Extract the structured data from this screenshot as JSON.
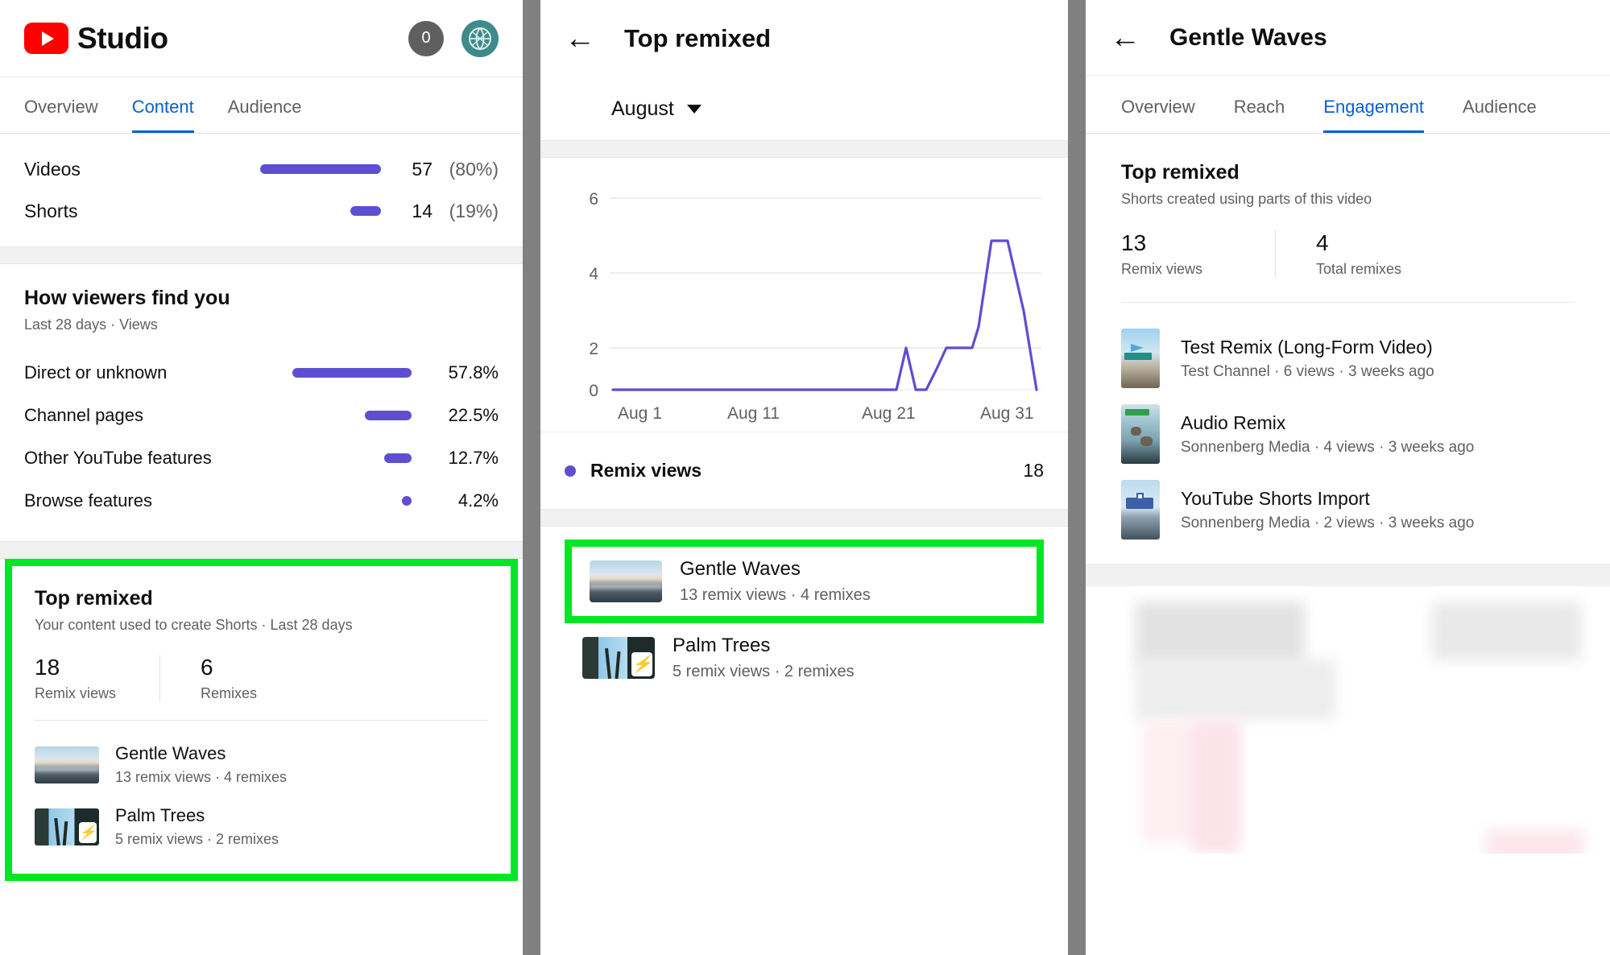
{
  "left": {
    "brand": {
      "name": "Studio",
      "logo_icon": "youtube-logo-icon",
      "badge_count": "0",
      "avatar_icon": "channel-avatar-icon"
    },
    "tabs": [
      {
        "label": "Overview",
        "active": false
      },
      {
        "label": "Content",
        "active": true
      },
      {
        "label": "Audience",
        "active": false
      }
    ],
    "content_breakdown": [
      {
        "label": "Videos",
        "count": "57",
        "pct": "(80%)",
        "bar_pct": 80
      },
      {
        "label": "Shorts",
        "count": "14",
        "pct": "(19%)",
        "bar_pct": 19
      }
    ],
    "traffic": {
      "title": "How viewers find you",
      "subtitle": "Last 28 days · Views",
      "rows": [
        {
          "label": "Direct or unknown",
          "value": "57.8%",
          "bar_pct": 100
        },
        {
          "label": "Channel pages",
          "value": "22.5%",
          "bar_pct": 39
        },
        {
          "label": "Other YouTube features",
          "value": "12.7%",
          "bar_pct": 22
        },
        {
          "label": "Browse features",
          "value": "4.2%",
          "bar_pct": 0
        }
      ]
    },
    "top_remixed": {
      "title": "Top remixed",
      "subtitle": "Your content used to create Shorts · Last 28 days",
      "stats": [
        {
          "value": "18",
          "caption": "Remix views"
        },
        {
          "value": "6",
          "caption": "Remixes"
        }
      ],
      "videos": [
        {
          "title": "Gentle Waves",
          "meta": "13 remix views · 4 remixes",
          "thumb": "waves"
        },
        {
          "title": "Palm Trees",
          "meta": "5 remix views · 2 remixes",
          "thumb": "palms",
          "shorts_badge": true
        }
      ]
    }
  },
  "mid": {
    "back_icon": "back-arrow-icon",
    "title": "Top remixed",
    "month": "August",
    "legend": {
      "label": "Remix views",
      "value": "18"
    },
    "videos": [
      {
        "title": "Gentle Waves",
        "meta": "13 remix views · 4 remixes",
        "thumb": "waves",
        "highlighted": true
      },
      {
        "title": "Palm Trees",
        "meta": "5 remix views · 2 remixes",
        "thumb": "palms",
        "shorts_badge": true,
        "highlighted": false
      }
    ]
  },
  "right": {
    "back_icon": "back-arrow-icon",
    "title": "Gentle Waves",
    "tabs": [
      {
        "label": "Overview",
        "active": false
      },
      {
        "label": "Reach",
        "active": false
      },
      {
        "label": "Engagement",
        "active": true
      },
      {
        "label": "Audience",
        "active": false
      }
    ],
    "top_remixed": {
      "title": "Top remixed",
      "subtitle": "Shorts created using parts of this video",
      "stats": [
        {
          "value": "13",
          "caption": "Remix views"
        },
        {
          "value": "4",
          "caption": "Total remixes"
        }
      ]
    },
    "remixes": [
      {
        "title": "Test Remix (Long-Form Video)",
        "meta": "Test Channel · 6 views · 3 weeks ago",
        "thumb": "testremix"
      },
      {
        "title": "Audio Remix",
        "meta": "Sonnenberg Media · 4 views · 3 weeks ago",
        "thumb": "audio"
      },
      {
        "title": "YouTube Shorts Import",
        "meta": "Sonnenberg Media · 2 views · 3 weeks ago",
        "thumb": "import"
      }
    ]
  },
  "colors": {
    "accent_blue": "#065fd4",
    "bar_purple": "#5e4ed1",
    "highlight_green": "#00e822",
    "youtube_red": "#ff0000",
    "shorts_red": "#ff0033"
  },
  "chart_data": {
    "type": "line",
    "title": "Remix views",
    "xlabel": "",
    "ylabel": "",
    "ylim": [
      0,
      6.8
    ],
    "yticks": [
      0,
      2,
      4,
      6
    ],
    "ytick_labels": [
      "0",
      "2",
      "4",
      "6"
    ],
    "xtick_labels": [
      "Aug 1",
      "Aug 11",
      "Aug 21",
      "Aug 31"
    ],
    "xticks": [
      1,
      11,
      21,
      31
    ],
    "grid": true,
    "legend_position": "below",
    "series": [
      {
        "name": "Remix views",
        "color": "#5e4ed1",
        "x": [
          1,
          2,
          3,
          4,
          5,
          6,
          7,
          8,
          9,
          10,
          11,
          12,
          13,
          14,
          15,
          16,
          17,
          18,
          19,
          20,
          21,
          22,
          23,
          24,
          25,
          26,
          27,
          28,
          29,
          30,
          31
        ],
        "values": [
          0,
          0,
          0,
          0,
          0,
          0,
          0,
          0,
          0,
          0,
          0,
          0,
          0,
          0,
          0,
          0,
          0,
          0,
          0,
          0,
          0,
          2,
          0,
          0,
          1,
          2,
          2,
          3,
          5,
          5,
          0
        ]
      }
    ],
    "total": 18
  }
}
